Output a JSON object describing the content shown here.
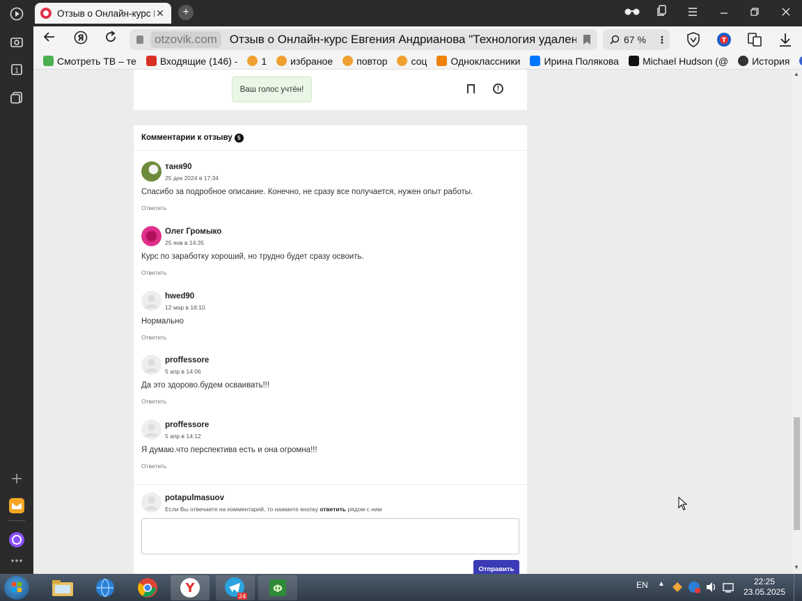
{
  "browser": {
    "tab_title": "Отзыв о Онлайн-курс Евгения Андрианова",
    "tab_close": "✕",
    "new_tab": "+",
    "url_domain": "otzovik.com",
    "url_title": "Отзыв о Онлайн-курс Евгения Андрианова \"Технология удаленного заработка\"",
    "zoom": "67 %",
    "bookmarks": [
      {
        "label": "Смотреть ТВ – те",
        "color": "#4caf50"
      },
      {
        "label": "Входящие (146) -",
        "color": "#d93025"
      },
      {
        "label": "1",
        "color": "#f0a030"
      },
      {
        "label": "избраное",
        "color": "#f0a030"
      },
      {
        "label": "повтор",
        "color": "#f0a030"
      },
      {
        "label": "соц",
        "color": "#f0a030"
      },
      {
        "label": "Одноклассники",
        "color": "#ee8208"
      },
      {
        "label": "Ирина Полякова",
        "color": "#0077ff"
      },
      {
        "label": "Michael Hudson (@",
        "color": "#111111"
      },
      {
        "label": "История",
        "color": "#333333"
      }
    ]
  },
  "review_card": {
    "vote_message": "Ваш голос учтён!"
  },
  "comments_section": {
    "title": "Комментарии к отзыву",
    "count": "5",
    "reply_label": "Ответить",
    "items": [
      {
        "author": "таня90",
        "date": "25 дек 2024 в 17:34",
        "text": "Спасибо за подробное описание. Конечно, не сразу все получается, нужен опыт работы.",
        "avatar_color": "#6d8a3a"
      },
      {
        "author": "Олег Громыко",
        "date": "25 янв в 14:35",
        "text": "Курс по заработку хороший, но трудно будет сразу освоить.",
        "avatar_color": "#e0308c"
      },
      {
        "author": "hwed90",
        "date": "12 мар в 16:10",
        "text": "Нормально",
        "avatar_color": "#eeeeee"
      },
      {
        "author": "proffessore",
        "date": "5 апр в 14:06",
        "text": "Да это здорово.будем осваивать!!!",
        "avatar_color": "#eeeeee"
      },
      {
        "author": "proffessore",
        "date": "5 апр в 14:12",
        "text": "Я думаю.что перспектива есть и она огромна!!!",
        "avatar_color": "#eeeeee"
      }
    ],
    "current_user": "potapulmasuov",
    "hint_before": "Если Вы отвечаете на комментарий, то нажмите кнопку ",
    "hint_bold": "ответить",
    "hint_after": " рядом с ним",
    "send_button": "Отправить"
  },
  "taskbar": {
    "lang": "EN",
    "time": "22:25",
    "date": "23.05.2025",
    "badge_telegram": "24"
  }
}
